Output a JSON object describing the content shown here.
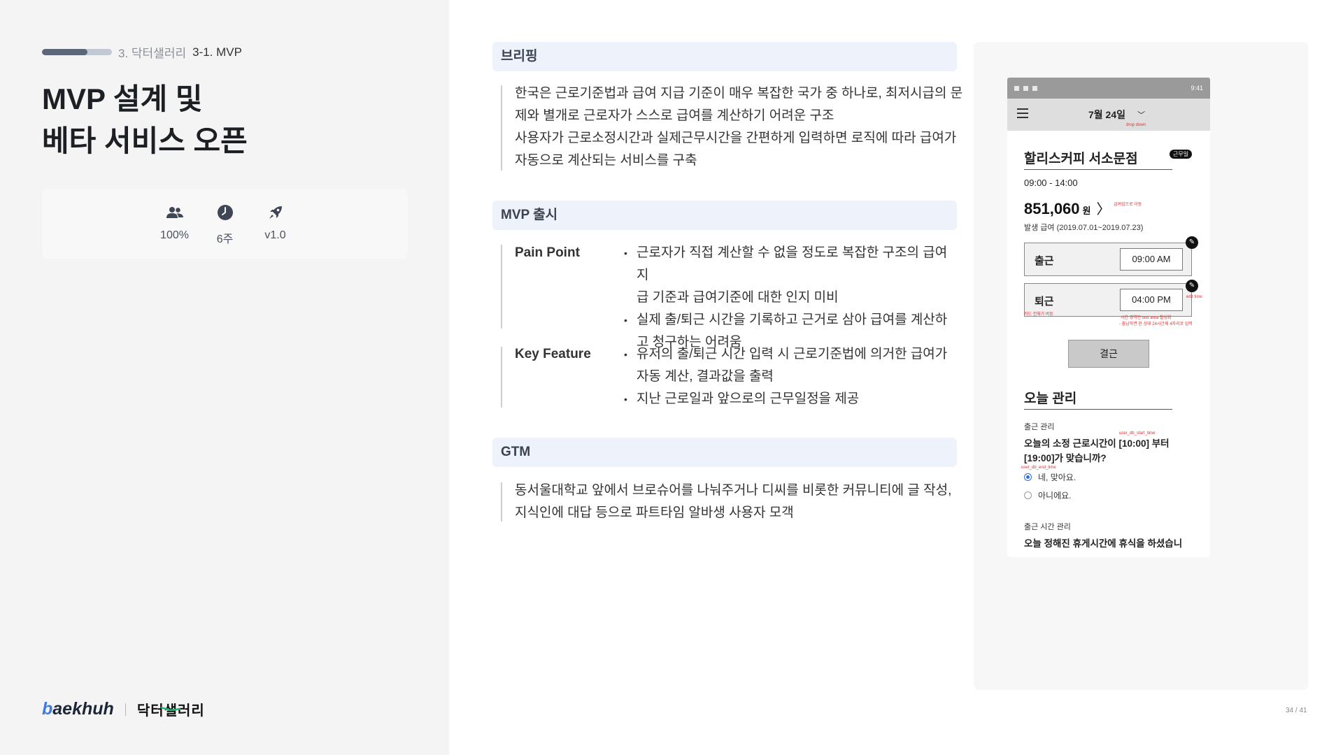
{
  "header": {
    "progress": 0.65,
    "section": "3. 닥터샐러리",
    "subsection": "3-1. MVP"
  },
  "title": {
    "line1": "MVP 설계 및",
    "line2": "베타 서비스 오픈"
  },
  "stats": [
    {
      "icon": "team-icon",
      "value": "100%"
    },
    {
      "icon": "clock-icon",
      "value": "6주"
    },
    {
      "icon": "rocket-icon",
      "value": "v1.0"
    }
  ],
  "logos": {
    "baekhuh_b": "b",
    "baekhuh_rest": "aekhuh",
    "drsalary_a": "닥터",
    "drsalary_b": "샐러리"
  },
  "briefing": {
    "heading": "브리핑",
    "lines": [
      "한국은 근로기준법과 급여 지급 기준이 매우 복잡한 국가 중 하나로, 최저시급의 문",
      "제와 별개로 근로자가 스스로 급여를 계산하기 어려운 구조",
      "사용자가 근로소정시간과 실제근무시간을 간편하게 입력하면 로직에 따라 급여가",
      "자동으로 계산되는 서비스를 구축"
    ]
  },
  "mvp": {
    "heading": "MVP 출시",
    "pain_label": "Pain Point",
    "pain_items": [
      {
        "l1": "근로자가 직접 계산할 수 없을 정도로 복잡한 구조의 급여지",
        "l2": "급 기준과 급여기준에 대한 인지 미비"
      },
      {
        "l1": "실제 출/퇴근 시간을 기록하고 근거로 삼아 급여를 계산하",
        "l2": "고 청구하는 어려움"
      }
    ],
    "feature_label": "Key Feature",
    "feature_items": [
      {
        "l1": "유저의 출/퇴근 시간 입력 시 근로기준법에 의거한 급여가",
        "l2": "자동 계산, 결과값을 출력"
      },
      {
        "l1": "지난 근로일과 앞으로의 근무일정을 제공",
        "l2": ""
      }
    ]
  },
  "gtm": {
    "heading": "GTM",
    "lines": [
      "동서울대학교 앞에서 브로슈어를 나눠주거나 디씨를 비롯한 커뮤니티에 글 작성,",
      "지식인에 대답 등으로 파트타임 알바생 사용자 모객"
    ]
  },
  "phone": {
    "status_time": "9:41",
    "date": "7월 24일",
    "date_note": "drop down",
    "store": "할리스커피 서소문점",
    "badge": "근무일",
    "hours": "09:00 - 14:00",
    "amount": "851,060",
    "currency": "원",
    "amount_note": "급여업으로 이동",
    "period": "발생 급여 (2019.07.01~2019.07.23)",
    "clock_in_label": "출근",
    "clock_in_time": "09:00 AM",
    "clock_out_label": "퇴근",
    "clock_out_time": "04:00 PM",
    "edit_note": "edit time",
    "card_note": "카드 전체가 버튼",
    "time_note_1": "시간 영역만 text area 활성화",
    "time_note_2": "- 출납하면 한 상태 24시간제 4자리로 입력",
    "absent_button": "결근",
    "manage_heading": "오늘 관리",
    "checkin_label": "출근 관리",
    "start_note": "user_db_start_time",
    "end_note": "user_db_end_time",
    "question1_l1": "오늘의 소정 근로시간이 [10:00] 부터",
    "question1_l2": "[19:00]가 맞습니까?",
    "option_yes": "네, 맞아요.",
    "option_no": "아니에요.",
    "time_label": "출근 시간 관리",
    "question2": "오늘 정해진 휴게시간에 휴식을 하셨습니"
  },
  "page_number": "34 / 41"
}
